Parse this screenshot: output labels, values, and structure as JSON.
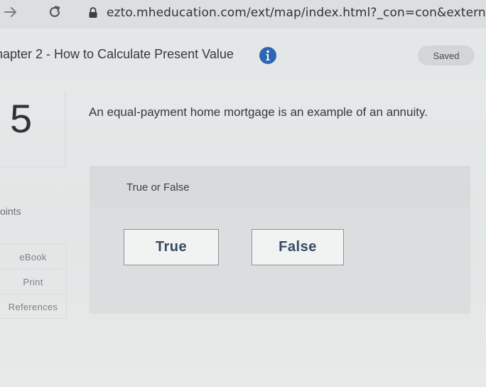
{
  "browser": {
    "url": "ezto.mheducation.com/ext/map/index.html?_con=con&external"
  },
  "header": {
    "chapter_title": "hapter 2 - How to Calculate Present Value",
    "saved_label": "Saved"
  },
  "sidebar": {
    "question_number": "5",
    "points_label": "oints",
    "links": [
      {
        "label": "eBook"
      },
      {
        "label": "Print"
      },
      {
        "label": "References"
      }
    ]
  },
  "question": {
    "text": "An equal-payment home mortgage is an example of an annuity.",
    "type_label": "True or False",
    "choices": [
      {
        "label": "True"
      },
      {
        "label": "False"
      }
    ]
  },
  "icons": {
    "forward": "forward-arrow-icon",
    "reload": "reload-icon",
    "lock": "lock-icon",
    "info": "info-icon"
  },
  "colors": {
    "info_icon": "#2d67b3",
    "choice_text": "#344a63"
  }
}
